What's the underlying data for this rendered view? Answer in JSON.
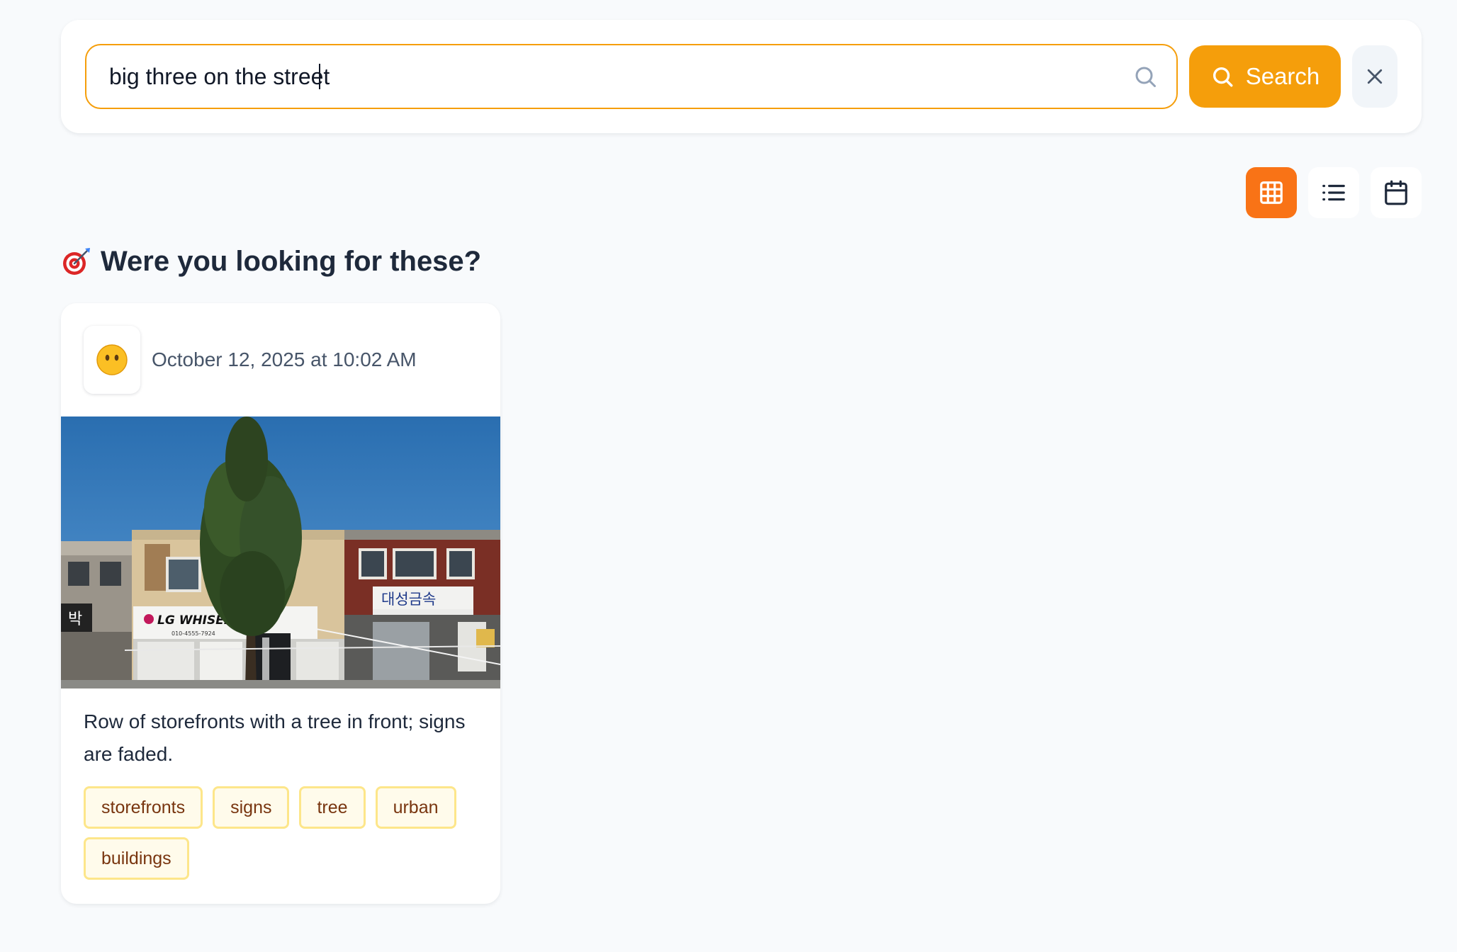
{
  "search": {
    "query": "big three on the street",
    "button_label": "Search"
  },
  "views": {
    "active": "grid",
    "items": [
      "grid",
      "list",
      "calendar"
    ]
  },
  "results": {
    "heading": "Were you looking for these?",
    "cards": [
      {
        "date": "October 12, 2025 at 10:02 AM",
        "caption": "Row of storefronts with a tree in front; signs are faded.",
        "tags": [
          "storefronts",
          "signs",
          "tree",
          "urban",
          "buildings"
        ],
        "photo_signs": {
          "lg_sign": "LG WHISEN",
          "lg_phone": "010-4555-7924",
          "right_sign": "대성금속",
          "left_sign": "박"
        }
      }
    ]
  },
  "colors": {
    "accent": "#f59e0b",
    "active_view": "#f97316",
    "tag_bg": "#fffbeb",
    "tag_border": "#fde68a",
    "tag_text": "#78350f"
  }
}
